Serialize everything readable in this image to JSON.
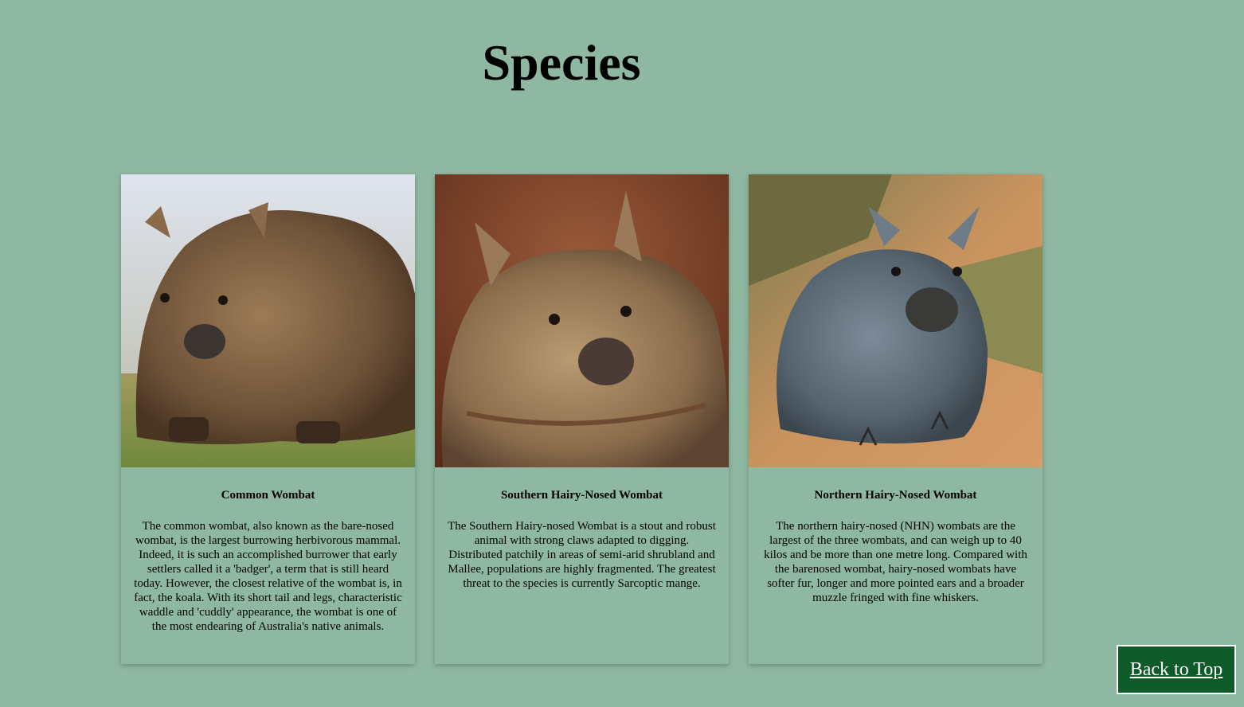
{
  "page": {
    "title": "Species"
  },
  "cards": [
    {
      "name": "Common Wombat",
      "text": "The common wombat, also known as the bare-nosed wombat, is the largest burrowing herbivorous mammal. Indeed, it is such an accomplished burrower that early settlers called it a 'badger', a term that is still heard today. However, the closest relative of the wombat is, in fact, the koala. With its short tail and legs, characteristic waddle and 'cuddly' appearance, the wombat is one of the most endearing of Australia's native animals."
    },
    {
      "name": "Southern Hairy-Nosed Wombat",
      "text": "The Southern Hairy-nosed Wombat is a stout and robust animal with strong claws adapted to digging. Distributed patchily in areas of semi-arid shrubland and Mallee, populations are highly fragmented. The greatest threat to the species is currently Sarcoptic mange."
    },
    {
      "name": "Northern Hairy-Nosed Wombat",
      "text": "The northern hairy-nosed (NHN) wombats are the largest of the three wombats, and can weigh up to 40 kilos and be more than one metre long. Compared with the barenosed wombat, hairy-nosed wombats have softer fur, longer and more pointed ears and a broader muzzle fringed with fine whiskers."
    }
  ],
  "back_to_top": {
    "label": "Back to Top"
  },
  "colors": {
    "background": "#8fb8a2",
    "button_bg": "#0e5a28",
    "button_text": "#ffffff"
  }
}
